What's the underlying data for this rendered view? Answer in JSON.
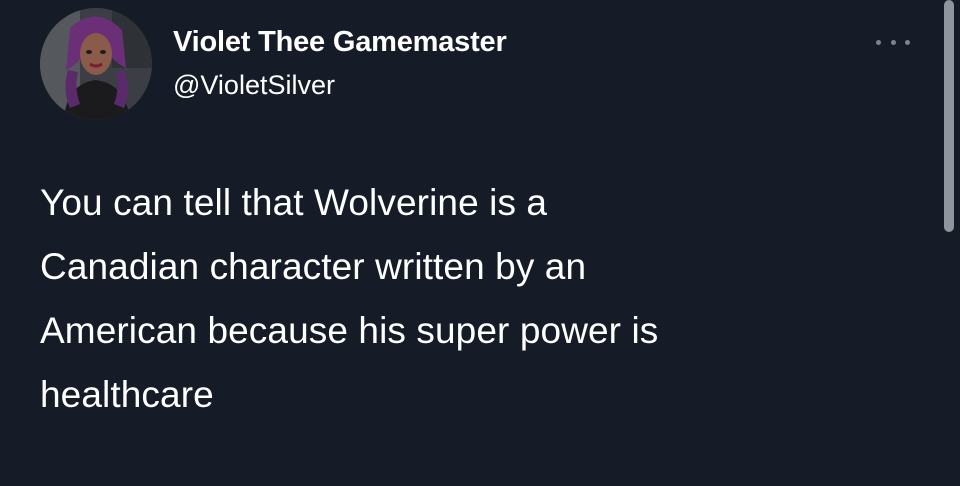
{
  "tweet": {
    "display_name": "Violet Thee Gamemaster",
    "handle": "@VioletSilver",
    "text_lines": [
      "You can tell that Wolverine is a",
      "Canadian character written by an",
      "American because his super power is",
      "healthcare"
    ]
  },
  "icons": {
    "more": "more-options-icon",
    "avatar": "profile-avatar"
  },
  "colors": {
    "background": "#151c27",
    "text": "#ffffff",
    "muted": "#7a8591"
  }
}
